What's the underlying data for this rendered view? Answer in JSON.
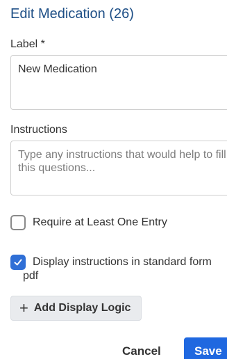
{
  "dialog": {
    "title": "Edit Medication (26)"
  },
  "label_field": {
    "label": "Label *",
    "value": "New Medication"
  },
  "instructions_field": {
    "label": "Instructions",
    "placeholder": "Type any instructions that would help to fill this questions..."
  },
  "options": {
    "require_entry": {
      "label": "Require at Least One Entry",
      "checked": false
    },
    "display_instructions": {
      "label": "Display instructions in standard form pdf",
      "checked": true
    }
  },
  "actions": {
    "add_display_logic": "Add Display Logic",
    "cancel": "Cancel",
    "save": "Save"
  },
  "colors": {
    "title": "#1e4f86",
    "primary": "#1f68e0",
    "checkbox_checked": "#2f6fd6"
  }
}
